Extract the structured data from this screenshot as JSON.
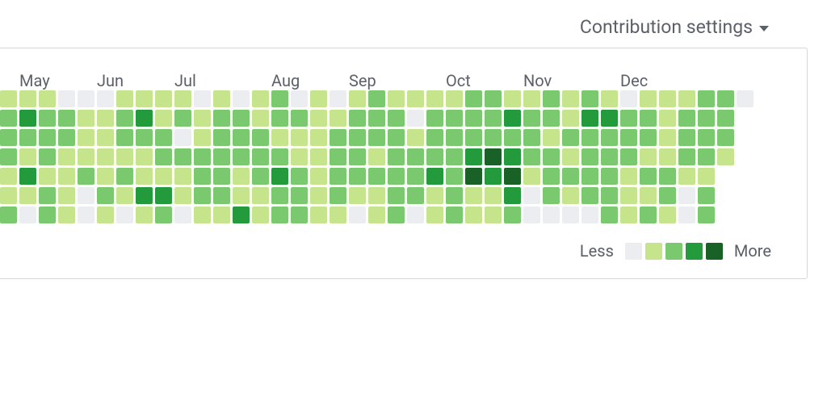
{
  "header": {
    "settings_label": "Contribution settings"
  },
  "legend": {
    "less_label": "Less",
    "more_label": "More"
  },
  "colors": {
    "levels": [
      "#ebedf0",
      "#c6e48b",
      "#7bc96f",
      "#239a3b",
      "#196127"
    ]
  },
  "chart_data": {
    "type": "heatmap",
    "title": "",
    "xlabel": "",
    "ylabel": "",
    "months": [
      {
        "label": "May",
        "week": 1
      },
      {
        "label": "Jun",
        "week": 5
      },
      {
        "label": "Jul",
        "week": 9
      },
      {
        "label": "Aug",
        "week": 14
      },
      {
        "label": "Sep",
        "week": 18
      },
      {
        "label": "Oct",
        "week": 23
      },
      {
        "label": "Nov",
        "week": 27
      },
      {
        "label": "Dec",
        "week": 32
      }
    ],
    "legend_levels": [
      0,
      1,
      2,
      3,
      4
    ],
    "weeks": [
      [
        1,
        2,
        2,
        2,
        1,
        1,
        2
      ],
      [
        1,
        3,
        2,
        1,
        3,
        1,
        0
      ],
      [
        1,
        2,
        2,
        2,
        1,
        2,
        2
      ],
      [
        0,
        2,
        2,
        1,
        1,
        1,
        1
      ],
      [
        0,
        1,
        1,
        1,
        2,
        0,
        0
      ],
      [
        0,
        1,
        1,
        1,
        1,
        2,
        1
      ],
      [
        1,
        2,
        2,
        1,
        2,
        1,
        0
      ],
      [
        1,
        3,
        2,
        1,
        1,
        3,
        1
      ],
      [
        1,
        1,
        2,
        2,
        1,
        3,
        2
      ],
      [
        1,
        2,
        0,
        2,
        1,
        1,
        0
      ],
      [
        0,
        1,
        1,
        2,
        2,
        2,
        1
      ],
      [
        1,
        2,
        2,
        2,
        2,
        2,
        1
      ],
      [
        0,
        2,
        2,
        2,
        1,
        1,
        3
      ],
      [
        1,
        1,
        2,
        2,
        2,
        1,
        1
      ],
      [
        2,
        2,
        1,
        2,
        3,
        2,
        2
      ],
      [
        0,
        2,
        1,
        1,
        2,
        2,
        2
      ],
      [
        1,
        1,
        1,
        1,
        1,
        1,
        1
      ],
      [
        0,
        1,
        2,
        2,
        2,
        2,
        1
      ],
      [
        1,
        2,
        2,
        2,
        2,
        1,
        0
      ],
      [
        2,
        2,
        2,
        1,
        2,
        1,
        1
      ],
      [
        1,
        2,
        2,
        2,
        2,
        2,
        2
      ],
      [
        1,
        0,
        1,
        2,
        2,
        2,
        0
      ],
      [
        1,
        2,
        2,
        2,
        3,
        1,
        1
      ],
      [
        1,
        2,
        2,
        2,
        2,
        2,
        2
      ],
      [
        2,
        2,
        2,
        3,
        4,
        1,
        1
      ],
      [
        2,
        2,
        2,
        4,
        3,
        1,
        1
      ],
      [
        1,
        3,
        2,
        3,
        4,
        3,
        2
      ],
      [
        1,
        2,
        2,
        2,
        1,
        0,
        0
      ],
      [
        2,
        2,
        1,
        2,
        2,
        2,
        0
      ],
      [
        1,
        1,
        2,
        1,
        2,
        1,
        0
      ],
      [
        2,
        3,
        2,
        2,
        2,
        2,
        0
      ],
      [
        1,
        3,
        2,
        2,
        2,
        2,
        2
      ],
      [
        0,
        2,
        2,
        2,
        1,
        1,
        1
      ],
      [
        1,
        2,
        2,
        1,
        2,
        1,
        2
      ],
      [
        1,
        1,
        1,
        1,
        2,
        2,
        1
      ],
      [
        1,
        2,
        2,
        2,
        1,
        0,
        0
      ],
      [
        2,
        2,
        2,
        2,
        1,
        2,
        2
      ],
      [
        2,
        2,
        2,
        1,
        null,
        null,
        null
      ],
      [
        0,
        null,
        null,
        null,
        null,
        null,
        null
      ]
    ]
  }
}
